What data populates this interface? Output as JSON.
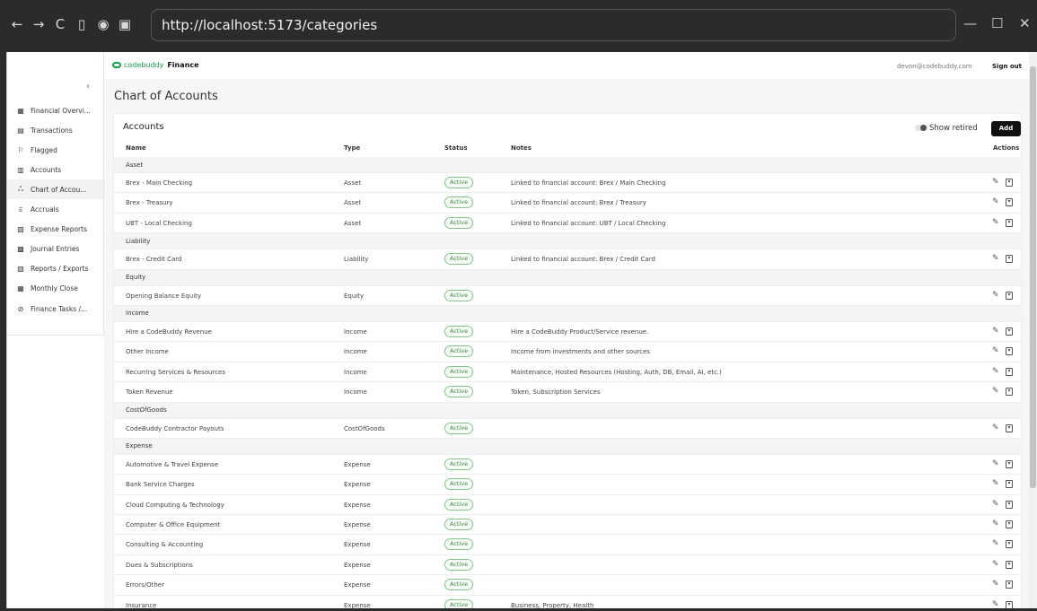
{
  "browser": {
    "url": "http://localhost:5173/categories",
    "nav_glyphs": [
      "←",
      "→",
      "C",
      "▯",
      "◉",
      "▣"
    ],
    "window_glyphs": [
      "—",
      "☐",
      "✕"
    ]
  },
  "sidebar": {
    "collapse_glyph": "‹",
    "items": [
      {
        "icon": "▦",
        "label": "Financial Overvi..."
      },
      {
        "icon": "▤",
        "label": "Transactions"
      },
      {
        "icon": "⚐",
        "label": "Flagged"
      },
      {
        "icon": "▥",
        "label": "Accounts"
      },
      {
        "icon": "ஃ",
        "label": "Chart of Accou..."
      },
      {
        "icon": "⩳",
        "label": "Accruals"
      },
      {
        "icon": "▧",
        "label": "Expense Reports"
      },
      {
        "icon": "▩",
        "label": "Journal Entries"
      },
      {
        "icon": "▨",
        "label": "Reports / Exports"
      },
      {
        "icon": "▦",
        "label": "Monthly Close"
      },
      {
        "icon": "⊘",
        "label": "Finance Tasks /..."
      }
    ],
    "active_index": 4
  },
  "header": {
    "brand": "codebuddy",
    "product": "Finance",
    "user_email": "devon@codebuddy.com",
    "sign_out": "Sign out"
  },
  "page": {
    "title": "Chart of Accounts"
  },
  "card": {
    "title": "Accounts",
    "show_retired": "Show retired",
    "add": "Add",
    "columns": {
      "name": "Name",
      "type": "Type",
      "status": "Status",
      "notes": "Notes",
      "actions": "Actions"
    },
    "groups": [
      {
        "label": "Asset",
        "rows": [
          {
            "name": "Brex - Main Checking",
            "type": "Asset",
            "status": "Active",
            "notes": "Linked to financial account: Brex / Main Checking"
          },
          {
            "name": "Brex - Treasury",
            "type": "Asset",
            "status": "Active",
            "notes": "Linked to financial account: Brex / Treasury"
          },
          {
            "name": "UBT - Local Checking",
            "type": "Asset",
            "status": "Active",
            "notes": "Linked to financial account: UBT / Local Checking"
          }
        ]
      },
      {
        "label": "Liability",
        "rows": [
          {
            "name": "Brex - Credit Card",
            "type": "Liability",
            "status": "Active",
            "notes": "Linked to financial account: Brex / Credit Card"
          }
        ]
      },
      {
        "label": "Equity",
        "rows": [
          {
            "name": "Opening Balance Equity",
            "type": "Equity",
            "status": "Active",
            "notes": ""
          }
        ]
      },
      {
        "label": "Income",
        "rows": [
          {
            "name": "Hire a CodeBuddy Revenue",
            "type": "Income",
            "status": "Active",
            "notes": "Hire a CodeBuddy Product/Service revenue."
          },
          {
            "name": "Other Income",
            "type": "Income",
            "status": "Active",
            "notes": "Income from investments and other sources"
          },
          {
            "name": "Recurring Services & Resources",
            "type": "Income",
            "status": "Active",
            "notes": "Maintenance, Hosted Resources (Hosting, Auth, DB, Email, AI, etc.)"
          },
          {
            "name": "Token Revenue",
            "type": "Income",
            "status": "Active",
            "notes": "Token, Subscription Services"
          }
        ]
      },
      {
        "label": "CostOfGoods",
        "rows": [
          {
            "name": "CodeBuddy Contractor Payouts",
            "type": "CostOfGoods",
            "status": "Active",
            "notes": ""
          }
        ]
      },
      {
        "label": "Expense",
        "rows": [
          {
            "name": "Automotive & Travel Expense",
            "type": "Expense",
            "status": "Active",
            "notes": ""
          },
          {
            "name": "Bank Service Charges",
            "type": "Expense",
            "status": "Active",
            "notes": ""
          },
          {
            "name": "Cloud Computing & Technology",
            "type": "Expense",
            "status": "Active",
            "notes": ""
          },
          {
            "name": "Computer & Office Equipment",
            "type": "Expense",
            "status": "Active",
            "notes": ""
          },
          {
            "name": "Consulting & Accounting",
            "type": "Expense",
            "status": "Active",
            "notes": ""
          },
          {
            "name": "Dues & Subscriptions",
            "type": "Expense",
            "status": "Active",
            "notes": ""
          },
          {
            "name": "Errors/Other",
            "type": "Expense",
            "status": "Active",
            "notes": ""
          },
          {
            "name": "Insurance",
            "type": "Expense",
            "status": "Active",
            "notes": "Business, Property, Health"
          }
        ]
      }
    ],
    "edit_glyph": "✎",
    "archive_glyph": "▾"
  },
  "colors": {
    "brand": "#16a34a",
    "active_badge_border": "#86c68b",
    "active_badge_text": "#3d8a42"
  }
}
